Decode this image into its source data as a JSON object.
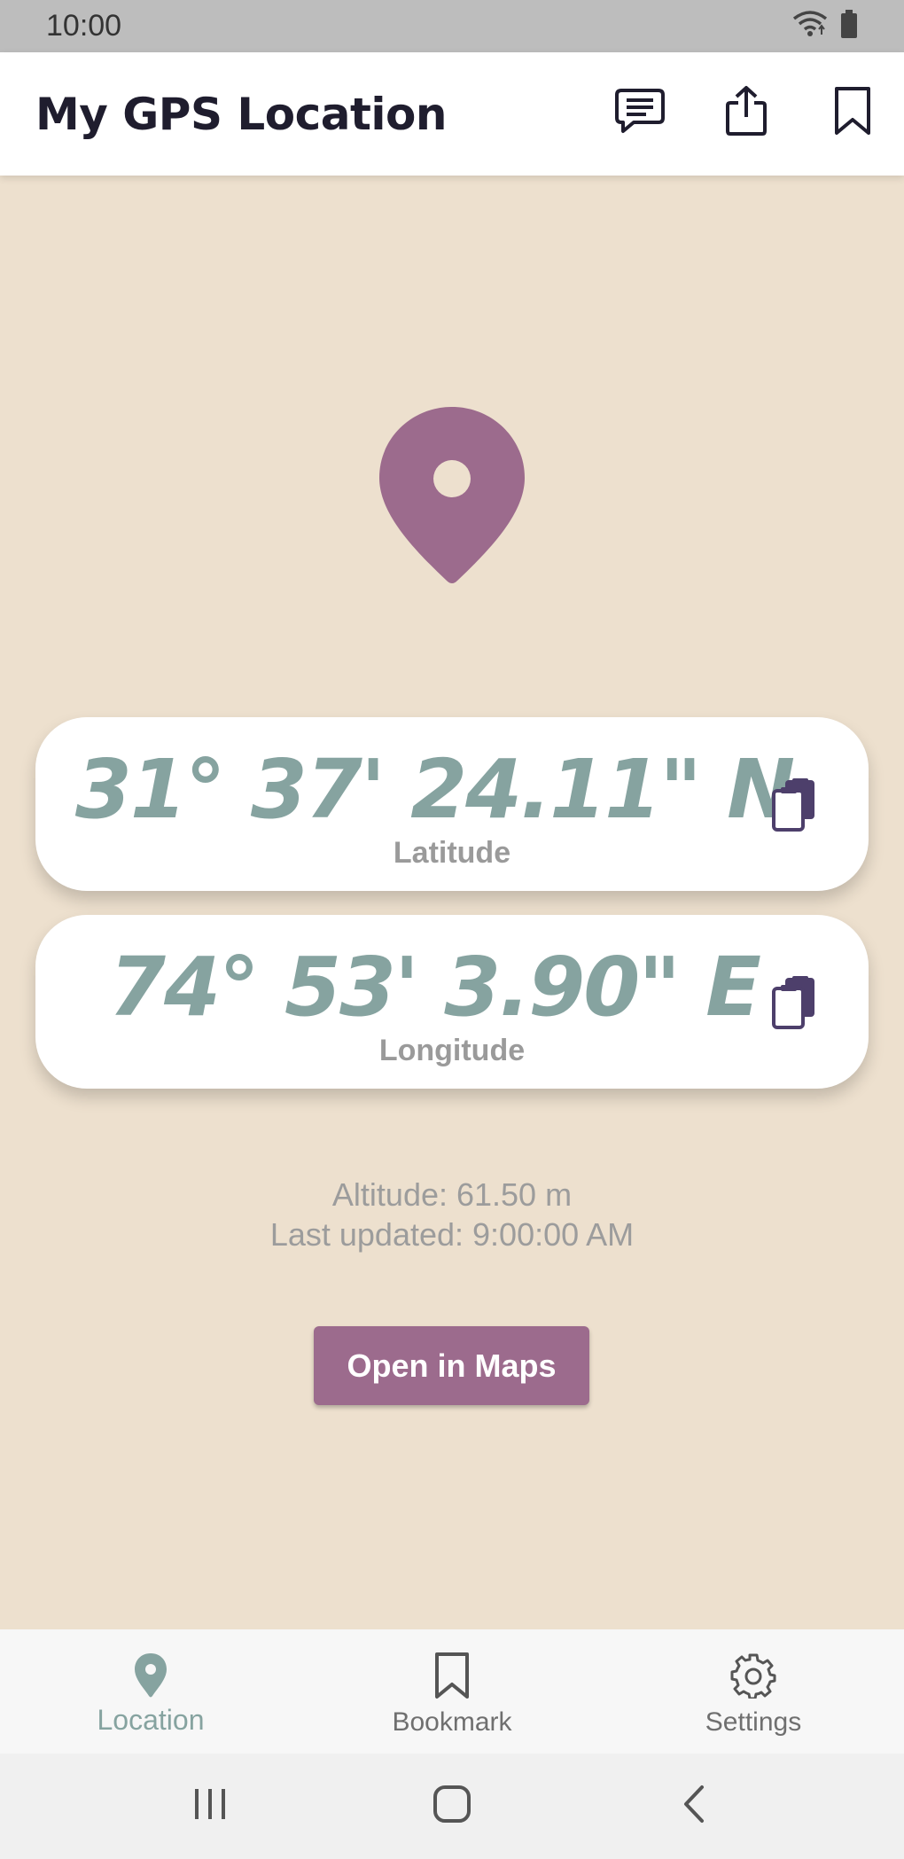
{
  "status_bar": {
    "time": "10:00"
  },
  "app_bar": {
    "title": "My GPS Location"
  },
  "location": {
    "latitude": "31° 37' 24.11\" N",
    "latitude_label": "Latitude",
    "longitude": "74° 53' 3.90\" E",
    "longitude_label": "Longitude",
    "altitude": "Altitude: 61.50 m",
    "last_updated": "Last updated: 9:00:00 AM"
  },
  "open_maps_label": "Open in Maps",
  "bottom_nav": {
    "items": [
      {
        "label": "Location",
        "icon": "location-pin-icon",
        "active": true
      },
      {
        "label": "Bookmark",
        "icon": "bookmark-icon",
        "active": false
      },
      {
        "label": "Settings",
        "icon": "gear-icon",
        "active": false
      }
    ]
  },
  "colors": {
    "background": "#ede0ce",
    "accent": "#9c6b8d",
    "coordinate_text": "#86a3a0",
    "nav_active": "#86a3a0",
    "copy_icon": "#4d3f6b"
  }
}
